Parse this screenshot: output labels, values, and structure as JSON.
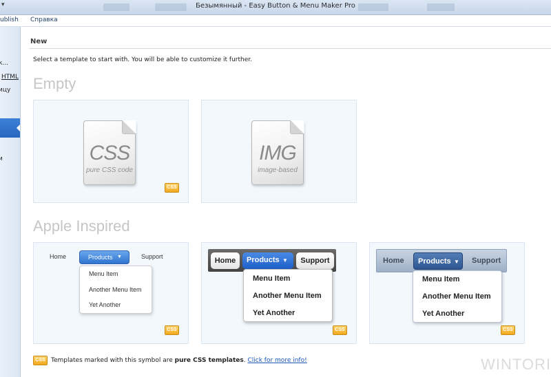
{
  "window": {
    "title": "Безымянный - Easy Button & Menu Maker Pro"
  },
  "ribbon": {
    "tabs": [
      "ublish",
      "Справка"
    ]
  },
  "sidebar": {
    "items": [
      "к...",
      "HTML",
      "ицу",
      "и"
    ]
  },
  "main": {
    "section_title": "New",
    "intro": "Select a template to start with. You will be able to customize it further.",
    "groups": [
      {
        "title": "Empty",
        "templates": [
          {
            "icon_text": "CSS",
            "icon_subtext": "pure CSS code",
            "badge": "CSS"
          },
          {
            "icon_text": "IMG",
            "icon_subtext": "image-based"
          }
        ]
      },
      {
        "title": "Apple Inspired",
        "templates": [
          {
            "nav": [
              "Home",
              "Products",
              "Support"
            ],
            "menu": [
              "Menu Item",
              "Another Menu Item",
              "Yet Another"
            ],
            "badge": "CSS"
          },
          {
            "nav": [
              "Home",
              "Products",
              "Support"
            ],
            "menu": [
              "Menu Item",
              "Another Menu Item",
              "Yet Another"
            ],
            "badge": "CSS"
          },
          {
            "nav": [
              "Home",
              "Products",
              "Support"
            ],
            "menu": [
              "Menu Item",
              "Another Menu Item",
              "Yet Another"
            ],
            "badge": "CSS"
          }
        ]
      }
    ]
  },
  "footer": {
    "badge": "CSS",
    "text_before": "Templates marked with this symbol are ",
    "text_bold": "pure CSS templates",
    "text_after": ". ",
    "link": "Click for more info!"
  },
  "watermark": "WINTORI",
  "colors": {
    "accent": "#2f74d0",
    "badge": "#f2a91e",
    "group_title": "#c6c6c6",
    "link": "#1a56b8"
  }
}
